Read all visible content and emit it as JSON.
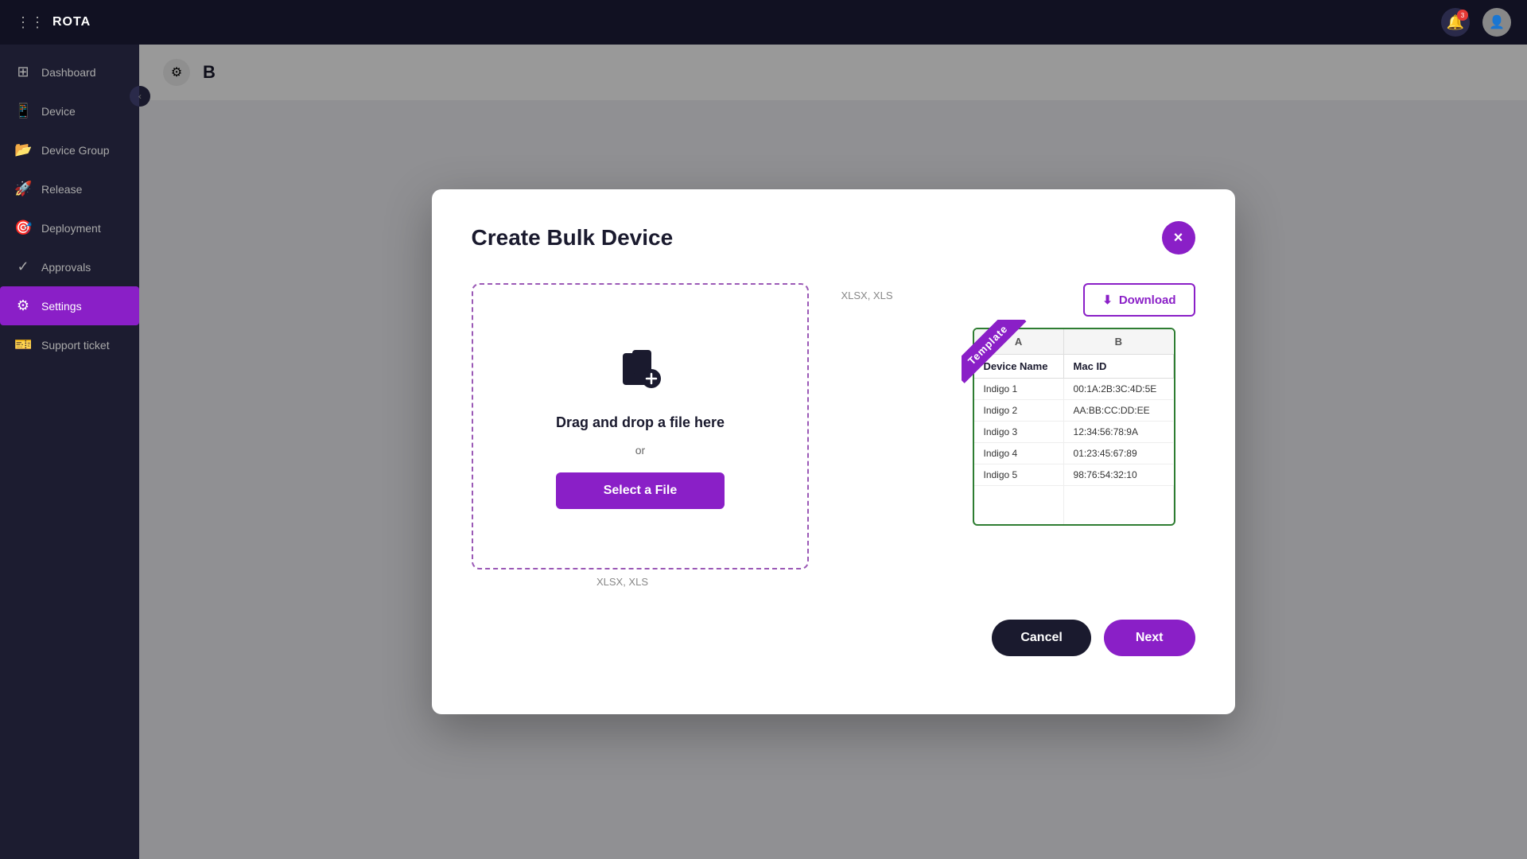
{
  "app": {
    "name": "ROTA"
  },
  "topbar": {
    "notification_count": "3",
    "avatar_initial": "👤"
  },
  "sidebar": {
    "items": [
      {
        "id": "dashboard",
        "label": "Dashboard",
        "icon": "⊞"
      },
      {
        "id": "device",
        "label": "Device",
        "icon": "📱"
      },
      {
        "id": "device-group",
        "label": "Device Group",
        "icon": "📂"
      },
      {
        "id": "release",
        "label": "Release",
        "icon": "🚀"
      },
      {
        "id": "deployment",
        "label": "Deployment",
        "icon": "🎯"
      },
      {
        "id": "approvals",
        "label": "Approvals",
        "icon": "✓"
      },
      {
        "id": "settings",
        "label": "Settings",
        "icon": "⚙"
      },
      {
        "id": "support-ticket",
        "label": "Support ticket",
        "icon": "🎫"
      }
    ],
    "active_item": "settings"
  },
  "modal": {
    "title": "Create Bulk Device",
    "close_label": "×",
    "dropzone": {
      "drag_text": "Drag and drop a file here",
      "or_text": "or",
      "select_btn_label": "Select a File",
      "formats_label": "XLSX, XLS"
    },
    "template": {
      "ribbon_label": "Template",
      "download_btn_label": "Download",
      "table": {
        "columns": [
          "A",
          "B"
        ],
        "headers": [
          "Device Name",
          "Mac ID"
        ],
        "rows": [
          [
            "Indigo 1",
            "00:1A:2B:3C:4D:5E"
          ],
          [
            "Indigo 2",
            "AA:BB:CC:DD:EE"
          ],
          [
            "Indigo 3",
            "12:34:56:78:9A"
          ],
          [
            "Indigo 4",
            "01:23:45:67:89"
          ],
          [
            "Indigo 5",
            "98:76:54:32:10"
          ]
        ]
      }
    },
    "footer": {
      "cancel_label": "Cancel",
      "next_label": "Next"
    }
  },
  "colors": {
    "accent": "#8a1fc7",
    "sidebar_bg": "#1c1c30",
    "topbar_bg": "#111122"
  }
}
